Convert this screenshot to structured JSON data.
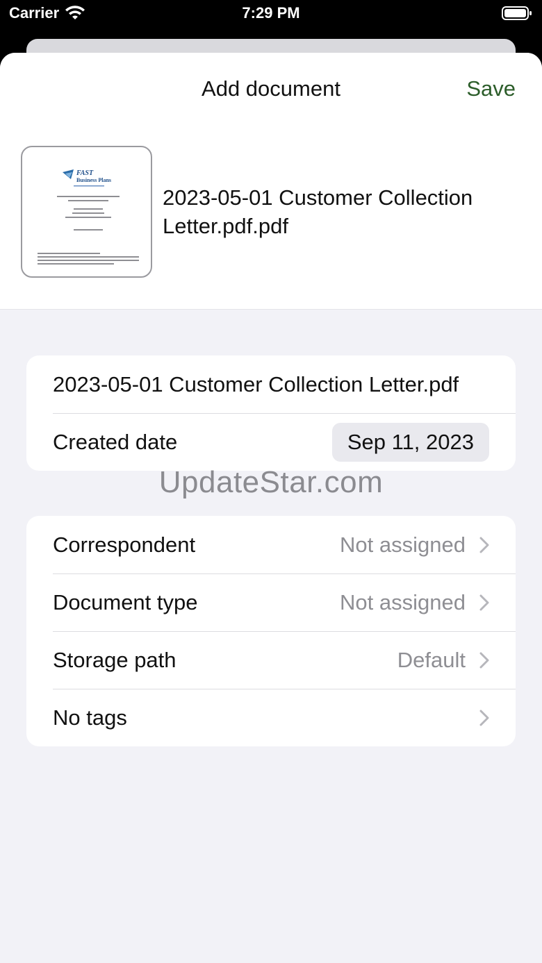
{
  "status_bar": {
    "carrier": "Carrier",
    "time": "7:29 PM",
    "icons": [
      "wifi-icon",
      "battery-icon"
    ]
  },
  "header": {
    "title": "Add document",
    "save_label": "Save",
    "file_name": "2023-05-01 Customer Collection Letter.pdf.pdf",
    "thumbnail": {
      "logo_text_1": "FAST",
      "logo_text_2": "Business Plans"
    }
  },
  "details": {
    "title_value": "2023-05-01 Customer Collection Letter.pdf",
    "created_date_label": "Created date",
    "created_date_value": "Sep 11, 2023"
  },
  "watermark": "UpdateStar.com",
  "metadata_rows": [
    {
      "label": "Correspondent",
      "value": "Not assigned"
    },
    {
      "label": "Document type",
      "value": "Not assigned"
    },
    {
      "label": "Storage path",
      "value": "Default"
    },
    {
      "label": "No tags",
      "value": ""
    }
  ],
  "colors": {
    "accent": "#2c5d2a",
    "background": "#f2f2f7",
    "secondary_text": "#8e8e93"
  }
}
